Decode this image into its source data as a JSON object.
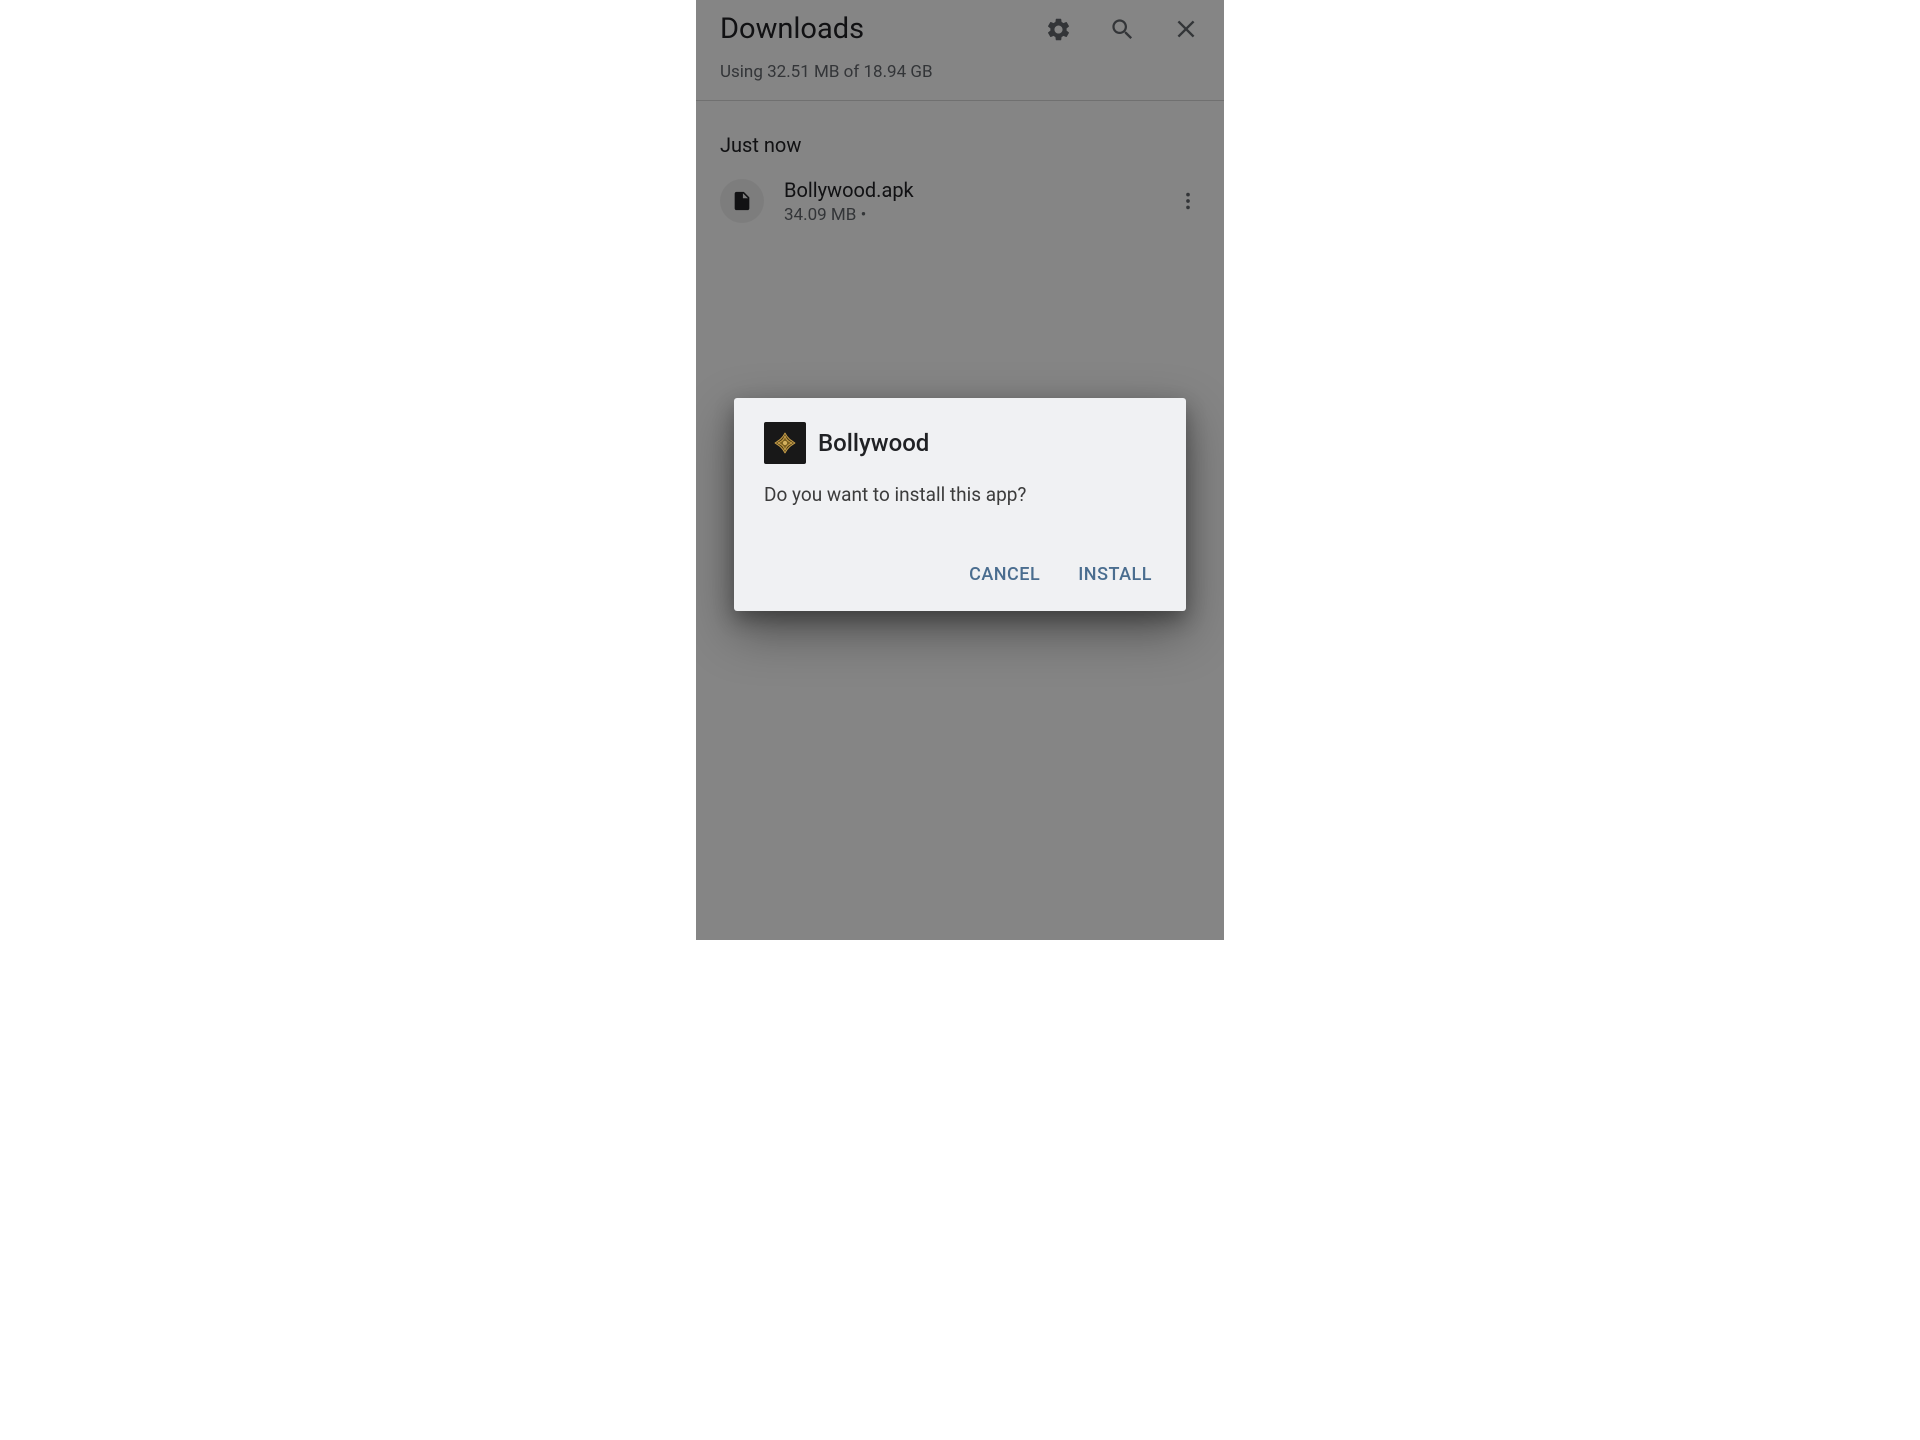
{
  "header": {
    "title": "Downloads"
  },
  "storage": {
    "text": "Using 32.51 MB of 18.94 GB"
  },
  "section": {
    "label": "Just now"
  },
  "file": {
    "name": "Bollywood.apk",
    "meta": "34.09 MB •"
  },
  "dialog": {
    "app_name": "Bollywood",
    "message": "Do you want to install this app?",
    "cancel_label": "CANCEL",
    "install_label": "INSTALL"
  }
}
